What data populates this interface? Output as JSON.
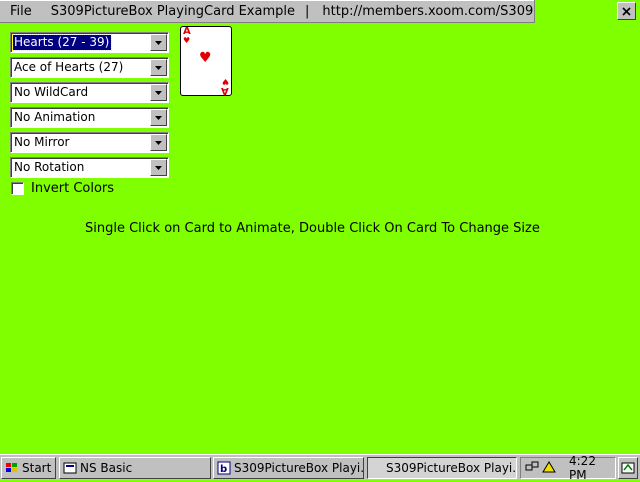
{
  "menubar": {
    "file": "File",
    "title": "S309PictureBox PlayingCard Example",
    "separator": "|",
    "url": "http://members.xoom.com/S309"
  },
  "controls": {
    "suit_range": "Hearts (27 - 39)",
    "card": "Ace of Hearts (27)",
    "wildcard": "No WildCard",
    "animation": "No Animation",
    "mirror": "No Mirror",
    "rotation": "No Rotation",
    "invert_label": "Invert Colors",
    "invert_checked": false
  },
  "playing_card": {
    "rank": "A",
    "suit_symbol": "♥",
    "color": "#e00000"
  },
  "instructions": "Single Click on Card to Animate, Double Click On Card To Change Size",
  "taskbar": {
    "start": "Start",
    "items": [
      "NS Basic",
      "S309PictureBox Playi...",
      "S309PictureBox Playi..."
    ],
    "clock": "4:22 PM"
  },
  "colors": {
    "background": "#80ff00",
    "chrome": "#c0c0c0",
    "selection": "#000080"
  }
}
